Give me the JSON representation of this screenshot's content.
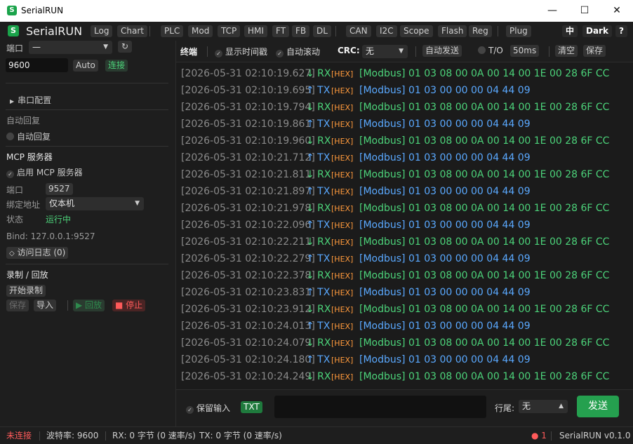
{
  "window": {
    "title": "SerialRUN",
    "app_icon_letter": "S",
    "minimize": "—",
    "maximize": "☐",
    "close": "✕"
  },
  "menubar": {
    "brand": "SerialRUN",
    "group1": [
      "Log",
      "Chart"
    ],
    "group2": [
      "PLC",
      "Mod",
      "TCP",
      "HMI",
      "FT",
      "FB",
      "DL"
    ],
    "group3": [
      "CAN",
      "I2C",
      "Scope",
      "Flash",
      "Reg"
    ],
    "group4": [
      "Plug"
    ],
    "lang": "中",
    "theme": "Dark",
    "help": "?"
  },
  "sidebar": {
    "port_label": "端口",
    "port_value": "—",
    "refresh_icon": "↻",
    "baud_value": "9600",
    "auto_btn": "Auto",
    "connect_btn": "连接",
    "serial_config": "串口配置",
    "auto_reply_section": "自动回复",
    "auto_reply_toggle": "自动回复",
    "mcp_title": "MCP 服务器",
    "mcp_enable": "启用 MCP 服务器",
    "mcp_port_label": "端口",
    "mcp_port_value": "9527",
    "bind_label": "绑定地址",
    "bind_value": "仅本机",
    "status_label": "状态",
    "status_value": "运行中",
    "bind_info": "Bind: 127.0.0.1:9527",
    "access_log": "访问日志 (0)",
    "record_title": "录制 / 回放",
    "start_record": "开始录制",
    "save": "保存",
    "import": "导入",
    "replay": "▶ 回放",
    "stop": "■ 停止"
  },
  "toolbar": {
    "terminal": "终端",
    "show_timestamp": "显示时间戳",
    "auto_scroll": "自动滚动",
    "crc_label": "CRC:",
    "crc_value": "无",
    "auto_send": "自动发送",
    "timeout_label": "T/O",
    "timeout_value": "50ms",
    "clear": "清空",
    "save": "保存"
  },
  "log": {
    "rows": [
      {
        "ts": "[2026-05-31 02:10:19.627]",
        "dir": "↓ RX",
        "fmt": "[HEX]",
        "payload": "[Modbus] 01 03 08 00 0A 00 14 00 1E 00 28 6F CC",
        "kind": "rx"
      },
      {
        "ts": "[2026-05-31 02:10:19.695]",
        "dir": "↑ TX",
        "fmt": "[HEX]",
        "payload": "[Modbus] 01 03 00 00 00 04 44 09",
        "kind": "tx"
      },
      {
        "ts": "[2026-05-31 02:10:19.794]",
        "dir": "↓ RX",
        "fmt": "[HEX]",
        "payload": "[Modbus] 01 03 08 00 0A 00 14 00 1E 00 28 6F CC",
        "kind": "rx"
      },
      {
        "ts": "[2026-05-31 02:10:19.861]",
        "dir": "↑ TX",
        "fmt": "[HEX]",
        "payload": "[Modbus] 01 03 00 00 00 04 44 09",
        "kind": "tx"
      },
      {
        "ts": "[2026-05-31 02:10:19.960]",
        "dir": "↓ RX",
        "fmt": "[HEX]",
        "payload": "[Modbus] 01 03 08 00 0A 00 14 00 1E 00 28 6F CC",
        "kind": "rx"
      },
      {
        "ts": "[2026-05-31 02:10:21.712]",
        "dir": "↑ TX",
        "fmt": "[HEX]",
        "payload": "[Modbus] 01 03 00 00 00 04 44 09",
        "kind": "tx"
      },
      {
        "ts": "[2026-05-31 02:10:21.811]",
        "dir": "↓ RX",
        "fmt": "[HEX]",
        "payload": "[Modbus] 01 03 08 00 0A 00 14 00 1E 00 28 6F CC",
        "kind": "rx"
      },
      {
        "ts": "[2026-05-31 02:10:21.897]",
        "dir": "↑ TX",
        "fmt": "[HEX]",
        "payload": "[Modbus] 01 03 00 00 00 04 44 09",
        "kind": "tx"
      },
      {
        "ts": "[2026-05-31 02:10:21.978]",
        "dir": "↓ RX",
        "fmt": "[HEX]",
        "payload": "[Modbus] 01 03 08 00 0A 00 14 00 1E 00 28 6F CC",
        "kind": "rx"
      },
      {
        "ts": "[2026-05-31 02:10:22.096]",
        "dir": "↑ TX",
        "fmt": "[HEX]",
        "payload": "[Modbus] 01 03 00 00 00 04 44 09",
        "kind": "tx"
      },
      {
        "ts": "[2026-05-31 02:10:22.211]",
        "dir": "↓ RX",
        "fmt": "[HEX]",
        "payload": "[Modbus] 01 03 08 00 0A 00 14 00 1E 00 28 6F CC",
        "kind": "rx"
      },
      {
        "ts": "[2026-05-31 02:10:22.279]",
        "dir": "↑ TX",
        "fmt": "[HEX]",
        "payload": "[Modbus] 01 03 00 00 00 04 44 09",
        "kind": "tx"
      },
      {
        "ts": "[2026-05-31 02:10:22.378]",
        "dir": "↓ RX",
        "fmt": "[HEX]",
        "payload": "[Modbus] 01 03 08 00 0A 00 14 00 1E 00 28 6F CC",
        "kind": "rx"
      },
      {
        "ts": "[2026-05-31 02:10:23.831]",
        "dir": "↑ TX",
        "fmt": "[HEX]",
        "payload": "[Modbus] 01 03 00 00 00 04 44 09",
        "kind": "tx"
      },
      {
        "ts": "[2026-05-31 02:10:23.912]",
        "dir": "↓ RX",
        "fmt": "[HEX]",
        "payload": "[Modbus] 01 03 08 00 0A 00 14 00 1E 00 28 6F CC",
        "kind": "rx"
      },
      {
        "ts": "[2026-05-31 02:10:24.013]",
        "dir": "↑ TX",
        "fmt": "[HEX]",
        "payload": "[Modbus] 01 03 00 00 00 04 44 09",
        "kind": "tx"
      },
      {
        "ts": "[2026-05-31 02:10:24.079]",
        "dir": "↓ RX",
        "fmt": "[HEX]",
        "payload": "[Modbus] 01 03 08 00 0A 00 14 00 1E 00 28 6F CC",
        "kind": "rx"
      },
      {
        "ts": "[2026-05-31 02:10:24.180]",
        "dir": "↑ TX",
        "fmt": "[HEX]",
        "payload": "[Modbus] 01 03 00 00 00 04 44 09",
        "kind": "tx"
      },
      {
        "ts": "[2026-05-31 02:10:24.249]",
        "dir": "↓ RX",
        "fmt": "[HEX]",
        "payload": "[Modbus] 01 03 08 00 0A 00 14 00 1E 00 28 6F CC",
        "kind": "rx"
      }
    ]
  },
  "sendbar": {
    "keep_input": "保留输入",
    "mode": "TXT",
    "input_value": "",
    "line_end_label": "行尾:",
    "line_end_value": "无",
    "send": "发送"
  },
  "status": {
    "conn": "未连接",
    "baud": "波特率: 9600",
    "rx": "RX: 0 字节 (0 速率/s)",
    "tx": "TX: 0 字节 (0 速率/s)",
    "alert": "● 1",
    "version": "SerialRUN v0.1.0"
  },
  "colors": {
    "accent_green": "#25a04f",
    "rx": "#4cd37a",
    "tx": "#5aa9ff",
    "hex_tag": "#ff9a3c",
    "error": "#ff5a5a"
  }
}
